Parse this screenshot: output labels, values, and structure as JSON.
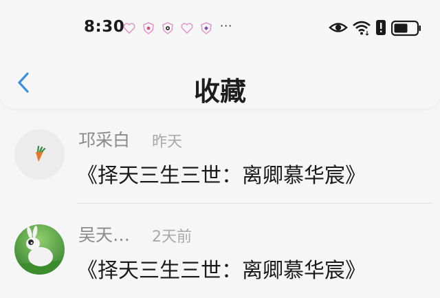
{
  "status_bar": {
    "time": "8:30",
    "more": "···",
    "notification_icons": [
      "heart-icon",
      "shield-icon",
      "robot-icon",
      "heart-icon",
      "diamond-icon"
    ],
    "system_icons": [
      "eye-icon",
      "wifi-icon",
      "alert-icon",
      "battery-icon"
    ]
  },
  "header": {
    "title": "收藏"
  },
  "favorites": [
    {
      "name": "邛采白",
      "time": "昨天",
      "book": "《择天三生三世：离卿慕华宸》",
      "avatar": "carrot-avatar"
    },
    {
      "name": "吴天…",
      "time": "2天前",
      "book": "《择天三生三世：离卿慕华宸》",
      "avatar": "rabbit-avatar"
    }
  ],
  "colors": {
    "accent": "#3a8ee6",
    "background": "#f6f6f7"
  }
}
